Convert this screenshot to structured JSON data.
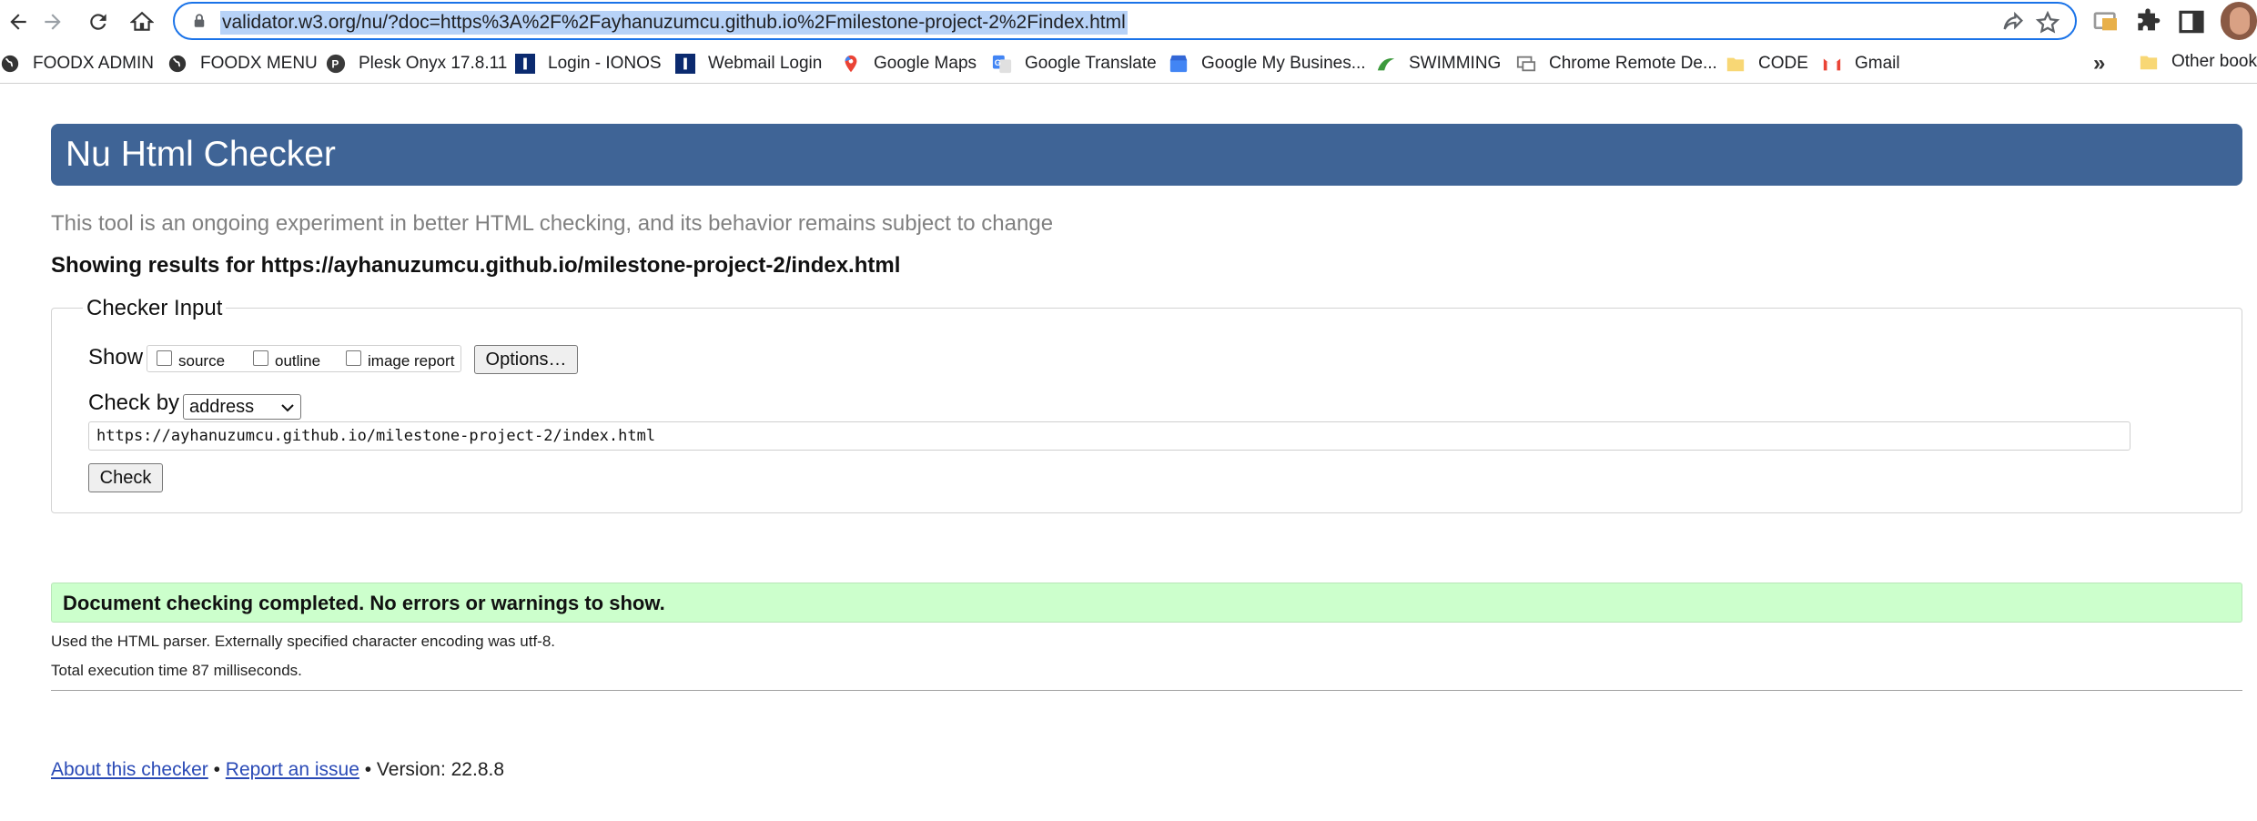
{
  "browser": {
    "url": "validator.w3.org/nu/?doc=https%3A%2F%2Fayhanuzumcu.github.io%2Fmilestone-project-2%2Findex.html"
  },
  "bookmarks": {
    "items": [
      {
        "label": "FOODX ADMIN",
        "icon": "globe-icon"
      },
      {
        "label": "FOODX MENU",
        "icon": "globe-icon"
      },
      {
        "label": "Plesk Onyx 17.8.11",
        "icon": "plesk-icon"
      },
      {
        "label": "Login - IONOS",
        "icon": "ionos-icon"
      },
      {
        "label": "Webmail Login",
        "icon": "ionos-icon"
      },
      {
        "label": "Google Maps",
        "icon": "maps-pin-icon"
      },
      {
        "label": "Google Translate",
        "icon": "translate-icon"
      },
      {
        "label": "Google My Busines...",
        "icon": "my-business-icon"
      },
      {
        "label": "SWIMMING",
        "icon": "swimming-icon"
      },
      {
        "label": "Chrome Remote De...",
        "icon": "remote-desktop-icon"
      },
      {
        "label": "CODE",
        "icon": "folder-icon"
      },
      {
        "label": "Gmail",
        "icon": "gmail-icon"
      }
    ],
    "more": "»",
    "other": "Other bookm"
  },
  "page": {
    "title": "Nu Html Checker",
    "subtitle": "This tool is an ongoing experiment in better HTML checking, and its behavior remains subject to change",
    "results_for": "Showing results for https://ayhanuzumcu.github.io/milestone-project-2/index.html",
    "checker_input": {
      "legend": "Checker Input",
      "show_label": "Show",
      "checkboxes": [
        "source",
        "outline",
        "image report"
      ],
      "options_button": "Options…",
      "check_by_label": "Check by",
      "check_by_value": "address",
      "url_value": "https://ayhanuzumcu.github.io/milestone-project-2/index.html",
      "check_button": "Check"
    },
    "result": {
      "message": "Document checking completed. No errors or warnings to show.",
      "parser": "Used the HTML parser. Externally specified character encoding was utf-8.",
      "time": "Total execution time 87 milliseconds."
    },
    "footer": {
      "about": "About this checker",
      "sep1": " • ",
      "report": "Report an issue",
      "version": " • Version: 22.8.8"
    }
  },
  "colors": {
    "header_bg": "#3f6496",
    "success_bg": "#ccffcc",
    "omnibox_border": "#1a73e8",
    "url_highlight": "#b7d2f7"
  }
}
